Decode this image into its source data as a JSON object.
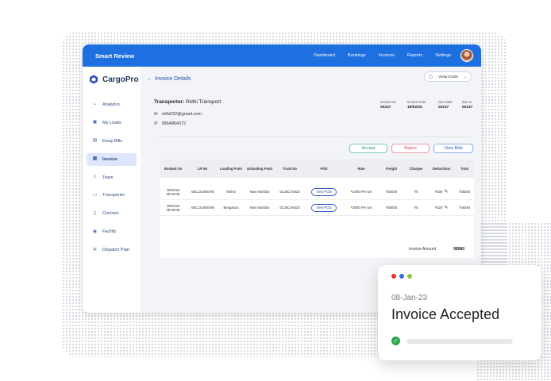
{
  "topbar": {
    "title": "Smart Review",
    "nav": [
      "Dashboard",
      "Bookings",
      "Invoices",
      "Reports",
      "Settings"
    ]
  },
  "sidebar": {
    "brand": "CargoPro",
    "items": [
      {
        "label": "Analytics",
        "icon": "chart-icon"
      },
      {
        "label": "My Loads",
        "icon": "box-icon"
      },
      {
        "label": "Eway Bills",
        "icon": "document-icon"
      },
      {
        "label": "Invoice",
        "icon": "invoice-icon",
        "active": true
      },
      {
        "label": "Team",
        "icon": "team-icon"
      },
      {
        "label": "Transporter",
        "icon": "truck-icon"
      },
      {
        "label": "Contract",
        "icon": "contract-icon"
      },
      {
        "label": "Facility",
        "icon": "location-icon"
      },
      {
        "label": "Dispatch Plan",
        "icon": "settings-icon"
      }
    ]
  },
  "main": {
    "back_label": "Invoice Details",
    "user": "Vedant Dalvi",
    "transporter_label": "Transporter:",
    "transporter_name": "Ridhi Transport",
    "email": "ridhi232@gmail.com",
    "phone": "9864864372",
    "meta": [
      {
        "label": "Invoice No",
        "value": "00237"
      },
      {
        "label": "Invoice Date",
        "value": "19/02/25"
      },
      {
        "label": "Due Date",
        "value": "00237"
      },
      {
        "label": "Due In",
        "value": "00237"
      }
    ],
    "actions": {
      "accept": "Accept",
      "reject": "Reject",
      "view_bills": "View Bills"
    },
    "table": {
      "headers": [
        "Booked On",
        "LR No",
        "Loading Point",
        "Unloading Point",
        "Truck No",
        "POD",
        "Rate",
        "Freight",
        "Charges",
        "Deductions",
        "Total"
      ],
      "rows": [
        [
          "19/02/25 08:30AM",
          "ABC123456789",
          "Mehsi",
          "Navi Mumbai",
          "DL25CA5533",
          "View POD",
          "₹1000 Per ton",
          "₹50000",
          "₹0",
          "₹500",
          "₹35500"
        ],
        [
          "19/02/25 08:30AM",
          "ABC123456789",
          "Bengaluru",
          "Navi Mumbai",
          "DL25CA5533",
          "View POD",
          "₹3000 Per ton",
          "₹60000",
          "₹0",
          "₹520",
          "₹46480"
        ]
      ],
      "amount_label": "Invoice Amount",
      "amount_value": "98980"
    }
  },
  "toast": {
    "date": "08-Jan-23",
    "title": "Invoice Accepted",
    "dot_colors": [
      "#e5322d",
      "#2f6fe0",
      "#8cc63f"
    ]
  }
}
